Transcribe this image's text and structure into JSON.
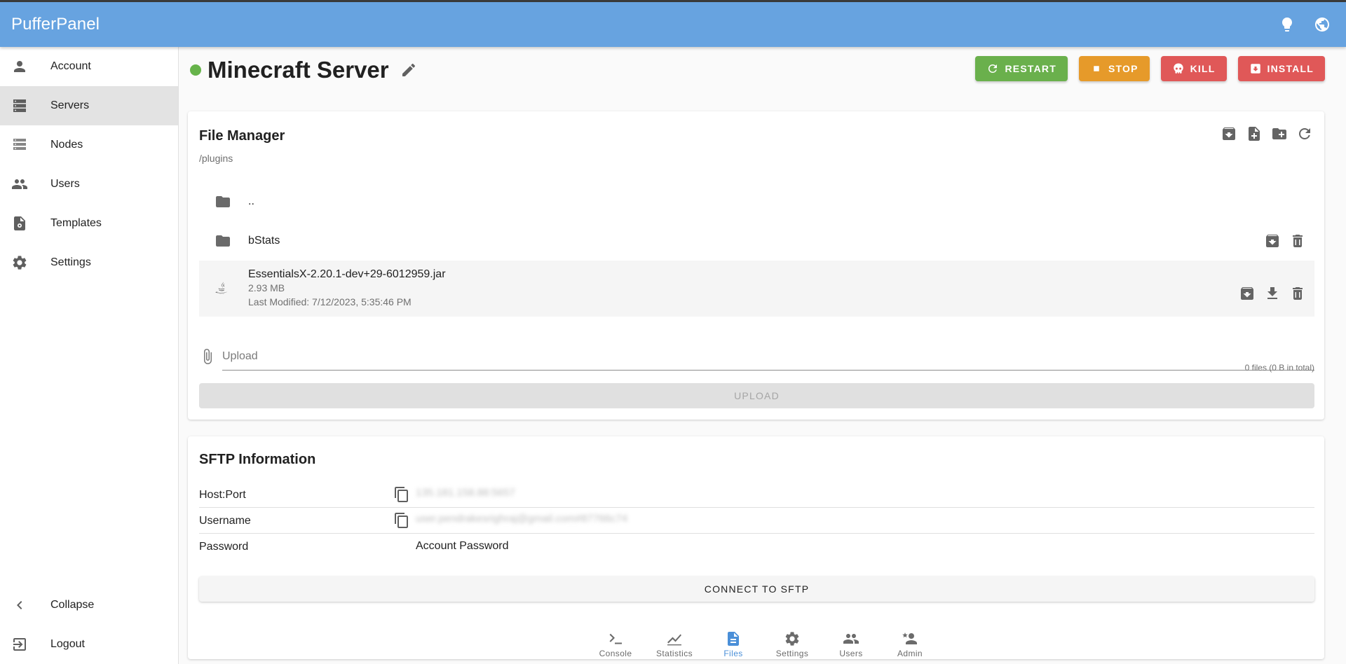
{
  "app": {
    "title": "PufferPanel"
  },
  "colors": {
    "accent": "#67a3e0",
    "online": "#66b34a",
    "restart": "#6ab04c",
    "stop": "#e69a2a",
    "danger": "#e05858"
  },
  "sidebar": {
    "items": [
      {
        "label": "Account",
        "icon": "account-icon"
      },
      {
        "label": "Servers",
        "icon": "servers-icon",
        "active": true
      },
      {
        "label": "Nodes",
        "icon": "nodes-icon"
      },
      {
        "label": "Users",
        "icon": "users-icon"
      },
      {
        "label": "Templates",
        "icon": "templates-icon"
      },
      {
        "label": "Settings",
        "icon": "gear-icon"
      }
    ],
    "bottom": [
      {
        "label": "Collapse",
        "icon": "chevron-left-icon"
      },
      {
        "label": "Logout",
        "icon": "logout-icon"
      }
    ]
  },
  "server": {
    "name": "Minecraft Server",
    "status": "online",
    "actions": {
      "restart": "RESTART",
      "stop": "STOP",
      "kill": "KILL",
      "install": "INSTALL"
    }
  },
  "file_manager": {
    "title": "File Manager",
    "path": "/plugins",
    "files": [
      {
        "name": "..",
        "type": "folder"
      },
      {
        "name": "bStats",
        "type": "folder"
      },
      {
        "name": "EssentialsX-2.20.1-dev+29-6012959.jar",
        "type": "file",
        "size": "2.93 MB",
        "modified": "Last Modified: 7/12/2023, 5:35:46 PM"
      }
    ],
    "upload": {
      "placeholder": "Upload",
      "count": "0 files (0 B in total)",
      "button": "UPLOAD"
    }
  },
  "sftp": {
    "title": "SFTP Information",
    "rows": [
      {
        "label": "Host:Port",
        "value": "135.181.158.88:5657"
      },
      {
        "label": "Username",
        "value": "user.pendrakesrighraj@gmail.com#87766c74"
      },
      {
        "label": "Password",
        "value": "Account Password"
      }
    ],
    "button": "CONNECT TO SFTP"
  },
  "bottom_nav": {
    "items": [
      {
        "label": "Console",
        "icon": "console-icon"
      },
      {
        "label": "Statistics",
        "icon": "statistics-icon"
      },
      {
        "label": "Files",
        "icon": "files-icon",
        "active": true
      },
      {
        "label": "Settings",
        "icon": "gear-icon"
      },
      {
        "label": "Users",
        "icon": "users-icon"
      },
      {
        "label": "Admin",
        "icon": "admin-icon"
      }
    ]
  }
}
